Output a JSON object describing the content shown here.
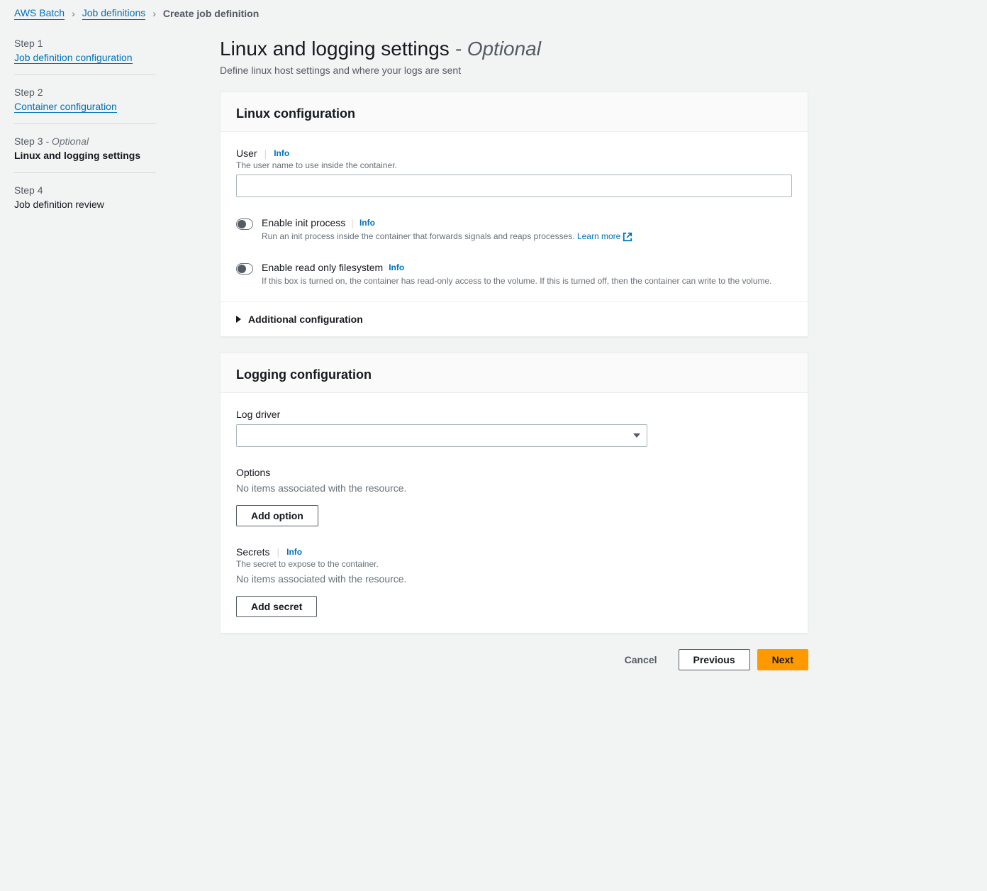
{
  "breadcrumb": {
    "root": "AWS Batch",
    "parent": "Job definitions",
    "current": "Create job definition"
  },
  "sidebar": {
    "steps": [
      {
        "label": "Step 1",
        "title": "Job definition configuration",
        "link": true
      },
      {
        "label": "Step 2",
        "title": "Container configuration",
        "link": true
      },
      {
        "label": "Step 3",
        "optional": "- Optional",
        "title": "Linux and logging settings",
        "active": true
      },
      {
        "label": "Step 4",
        "title": "Job definition review"
      }
    ]
  },
  "page": {
    "title_main": "Linux and logging settings ",
    "title_sep": "- ",
    "title_optional": "Optional",
    "subtitle": "Define linux host settings and where your logs are sent"
  },
  "linux": {
    "card_title": "Linux configuration",
    "user": {
      "label": "User",
      "info": "Info",
      "description": "The user name to use inside the container.",
      "value": ""
    },
    "init": {
      "label": "Enable init process",
      "info": "Info",
      "description": "Run an init process inside the container that forwards signals and reaps processes. ",
      "learn_more": "Learn more"
    },
    "readonly": {
      "label": "Enable read only filesystem",
      "info": "Info",
      "description": "If this box is turned on, the container has read-only access to the volume. If this is turned off, then the container can write to the volume."
    },
    "additional": "Additional configuration"
  },
  "logging": {
    "card_title": "Logging configuration",
    "log_driver": {
      "label": "Log driver",
      "value": ""
    },
    "options": {
      "label": "Options",
      "empty": "No items associated with the resource.",
      "add_button": "Add option"
    },
    "secrets": {
      "label": "Secrets",
      "info": "Info",
      "description": "The secret to expose to the container.",
      "empty": "No items associated with the resource.",
      "add_button": "Add secret"
    }
  },
  "footer": {
    "cancel": "Cancel",
    "previous": "Previous",
    "next": "Next"
  }
}
